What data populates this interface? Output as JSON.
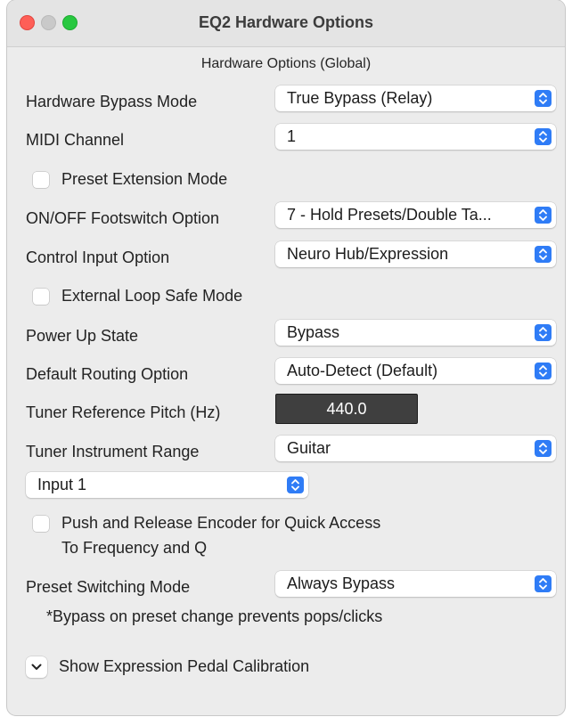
{
  "window": {
    "title": "EQ2 Hardware Options"
  },
  "section_title": "Hardware Options (Global)",
  "rows": {
    "bypass_mode": {
      "label": "Hardware Bypass Mode",
      "value": "True Bypass (Relay)"
    },
    "midi_channel": {
      "label": "MIDI Channel",
      "value": "1"
    },
    "preset_extension": {
      "label": "Preset Extension Mode",
      "checked": false
    },
    "footswitch": {
      "label": "ON/OFF Footswitch Option",
      "value": "7 - Hold Presets/Double Ta..."
    },
    "control_input": {
      "label": "Control Input Option",
      "value": "Neuro Hub/Expression"
    },
    "external_loop": {
      "label": "External Loop Safe Mode",
      "checked": false
    },
    "power_up": {
      "label": "Power Up State",
      "value": "Bypass"
    },
    "routing": {
      "label": "Default Routing Option",
      "value": "Auto-Detect (Default)"
    },
    "tuner_pitch": {
      "label": "Tuner Reference Pitch (Hz)",
      "value": "440.0"
    },
    "tuner_range": {
      "label": "Tuner Instrument Range",
      "value": "Guitar"
    },
    "input_select": {
      "value": "Input 1"
    },
    "encoder_quick": {
      "label_line1": "Push and Release Encoder for Quick Access",
      "label_line2": "To Frequency and Q",
      "checked": false
    },
    "preset_switching": {
      "label": "Preset Switching Mode",
      "value": "Always Bypass"
    }
  },
  "note": "*Bypass on preset change prevents pops/clicks",
  "expression_toggle": {
    "label": "Show Expression Pedal Calibration"
  },
  "colors": {
    "accent": "#2f7cf6",
    "close": "#fe5f57",
    "minimize": "#c9c9c9",
    "maximize": "#28c840"
  }
}
